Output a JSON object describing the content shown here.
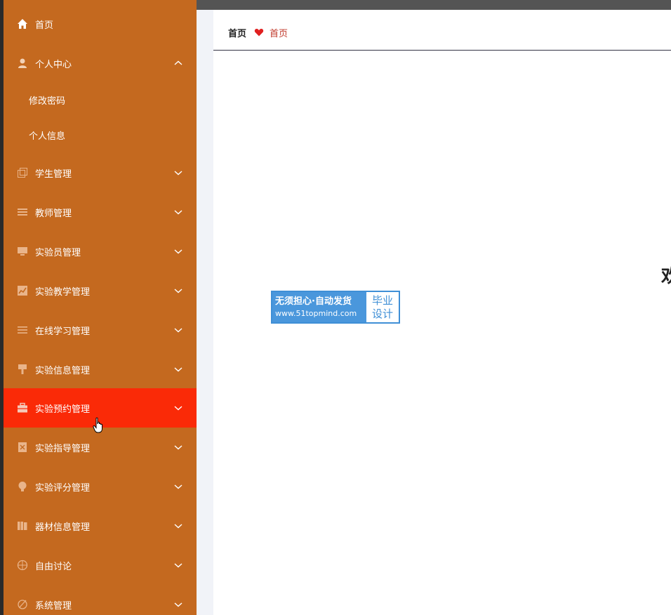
{
  "sidebar": {
    "items": [
      {
        "label": "首页",
        "icon": "home-icon"
      },
      {
        "label": "个人中心",
        "icon": "user-icon",
        "expanded": true,
        "children": [
          {
            "label": "修改密码"
          },
          {
            "label": "个人信息"
          }
        ]
      },
      {
        "label": "学生管理",
        "icon": "copy-icon"
      },
      {
        "label": "教师管理",
        "icon": "list-icon"
      },
      {
        "label": "实验员管理",
        "icon": "monitor-icon"
      },
      {
        "label": "实验教学管理",
        "icon": "chart-icon"
      },
      {
        "label": "在线学习管理",
        "icon": "menu-icon"
      },
      {
        "label": "实验信息管理",
        "icon": "pin-icon"
      },
      {
        "label": "实验预约管理",
        "icon": "briefcase-icon",
        "active": true
      },
      {
        "label": "实验指导管理",
        "icon": "file-icon"
      },
      {
        "label": "实验评分管理",
        "icon": "bulb-icon"
      },
      {
        "label": "器材信息管理",
        "icon": "books-icon"
      },
      {
        "label": "自由讨论",
        "icon": "compass-icon"
      },
      {
        "label": "系统管理",
        "icon": "no-icon"
      }
    ]
  },
  "breadcrumb": {
    "home": "首页",
    "current": "首页"
  },
  "main": {
    "welcome_partial": "欢"
  },
  "watermark": {
    "line1": "无须担心·自动发货",
    "line2": "www.51topmind.com",
    "right1": "毕业",
    "right2": "设计"
  },
  "colors": {
    "sidebar_bg": "#c4691f",
    "active_bg": "#fa2a07",
    "crumb_red": "#c0392b",
    "heart": "#e02020"
  }
}
